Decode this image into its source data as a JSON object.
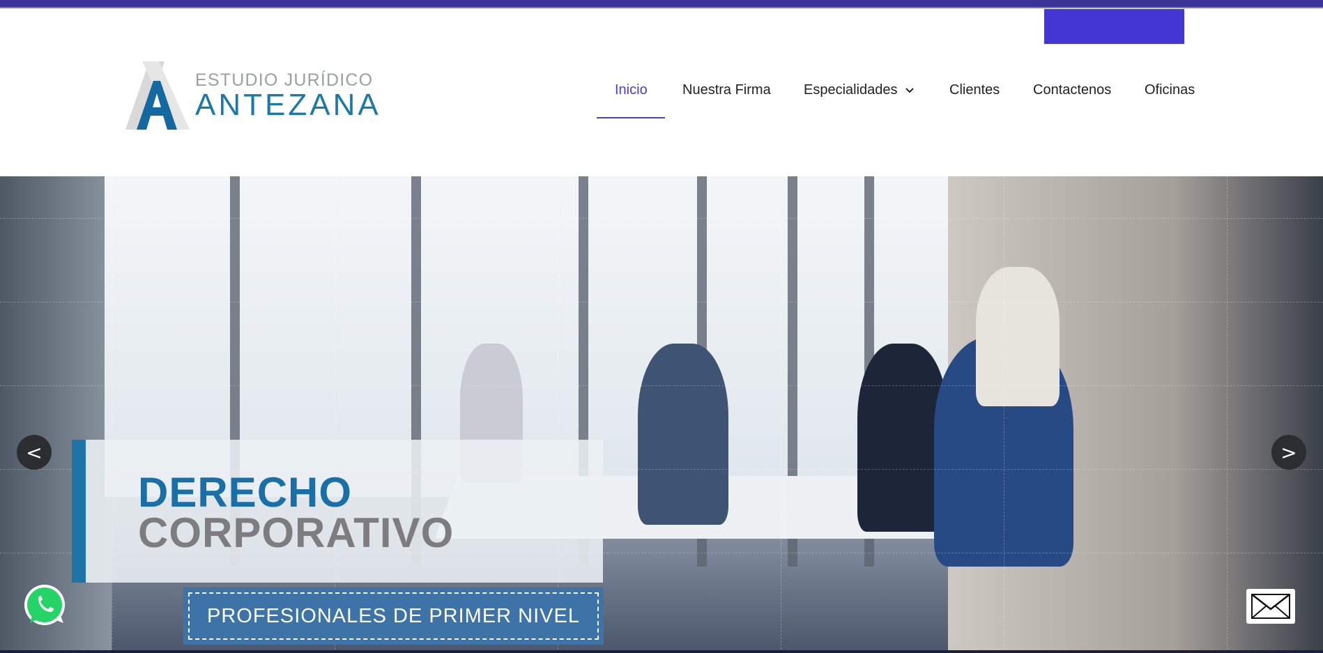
{
  "logo": {
    "line1": "ESTUDIO JURÍDICO",
    "line2": "ANTEZANA"
  },
  "nav": {
    "items": [
      {
        "label": "Inicio",
        "active": true
      },
      {
        "label": "Nuestra Firma",
        "active": false
      },
      {
        "label": "Especialidades",
        "active": false,
        "dropdown": true
      },
      {
        "label": "Clientes",
        "active": false
      },
      {
        "label": "Contactenos",
        "active": false
      },
      {
        "label": "Oficinas",
        "active": false
      }
    ]
  },
  "hero": {
    "title_line1": "DERECHO",
    "title_line2": "CORPORATIVO",
    "tagline": "PROFESIONALES DE PRIMER NIVEL",
    "prev_label": "<",
    "next_label": ">"
  },
  "icons": {
    "whatsapp": "whatsapp-icon",
    "mail": "mail-icon",
    "chevron": "chevron-down-icon"
  },
  "colors": {
    "brand_blue": "#1e78a7",
    "accent_purple": "#4a3fc6",
    "top_bar": "#3b3496",
    "tag_blue": "#3d73a6"
  }
}
